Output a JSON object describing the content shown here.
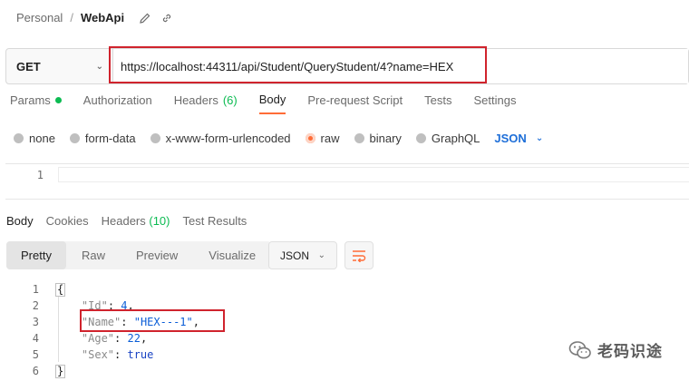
{
  "breadcrumb": {
    "workspace": "Personal",
    "separator": "/",
    "request_name": "WebApi"
  },
  "request": {
    "method": "GET",
    "url": "https://localhost:44311/api/Student/QueryStudent/4?name=HEX"
  },
  "request_tabs": [
    {
      "label": "Params"
    },
    {
      "label": "Authorization"
    },
    {
      "label": "Headers",
      "count": "(6)"
    },
    {
      "label": "Body"
    },
    {
      "label": "Pre-request Script"
    },
    {
      "label": "Tests"
    },
    {
      "label": "Settings"
    }
  ],
  "body_types": [
    {
      "label": "none"
    },
    {
      "label": "form-data"
    },
    {
      "label": "x-www-form-urlencoded"
    },
    {
      "label": "raw",
      "selected": true
    },
    {
      "label": "binary"
    },
    {
      "label": "GraphQL"
    }
  ],
  "body_format": "JSON",
  "request_editor": {
    "line": "1"
  },
  "response_tabs": [
    {
      "label": "Body"
    },
    {
      "label": "Cookies"
    },
    {
      "label": "Headers",
      "count": "(10)"
    },
    {
      "label": "Test Results"
    }
  ],
  "view_modes": [
    "Pretty",
    "Raw",
    "Preview",
    "Visualize"
  ],
  "response_format": "JSON",
  "response_lines": [
    {
      "n": "1",
      "t": "{"
    },
    {
      "n": "2",
      "key": "\"Id\"",
      "val": "4",
      "vt": "n",
      "end": ","
    },
    {
      "n": "3",
      "key": "\"Name\"",
      "val": "\"HEX---1\"",
      "vt": "s",
      "end": ","
    },
    {
      "n": "4",
      "key": "\"Age\"",
      "val": "22",
      "vt": "n",
      "end": ","
    },
    {
      "n": "5",
      "key": "\"Sex\"",
      "val": "true",
      "vt": "b",
      "end": ""
    },
    {
      "n": "6",
      "t": "}"
    }
  ],
  "watermark": "老码识途",
  "colors": {
    "accent": "#ff6c37",
    "green": "#0cbb52",
    "highlight": "#d0232d",
    "link_blue": "#1d6ed8"
  }
}
